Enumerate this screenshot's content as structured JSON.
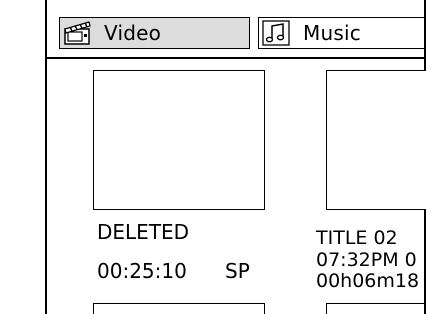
{
  "tabs": [
    {
      "label": "Video",
      "icon": "clapperboard-icon",
      "active": true
    },
    {
      "label": "Music",
      "icon": "music-note-icon",
      "active": false
    }
  ],
  "items": [
    {
      "title": "DELETED",
      "line2": "00:25:10",
      "mode": "SP"
    },
    {
      "title": "TITLE 02",
      "line2": "07:32PM 0",
      "line3": "00h06m18"
    }
  ],
  "colors": {
    "active_tab": "#dcdcdc",
    "border": "#000000",
    "background": "#ffffff"
  }
}
